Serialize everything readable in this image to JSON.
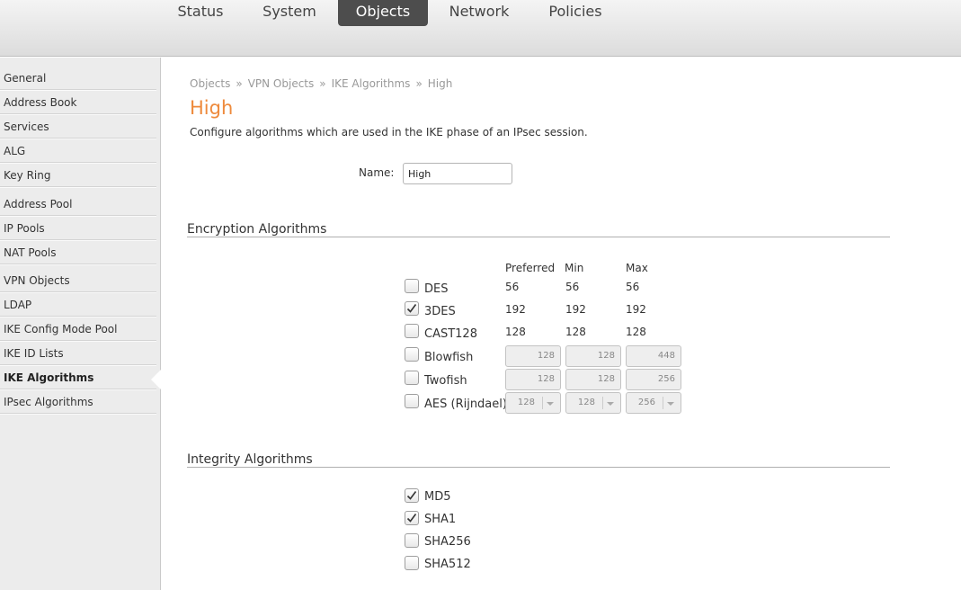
{
  "nav": {
    "tabs": [
      {
        "label": "Status",
        "active": false
      },
      {
        "label": "System",
        "active": false
      },
      {
        "label": "Objects",
        "active": true
      },
      {
        "label": "Network",
        "active": false
      },
      {
        "label": "Policies",
        "active": false
      }
    ]
  },
  "sidebar": {
    "items": [
      {
        "label": "General",
        "active": false
      },
      {
        "label": "Address Book",
        "active": false
      },
      {
        "label": "Services",
        "active": false
      },
      {
        "label": "ALG",
        "active": false
      },
      {
        "label": "Key Ring",
        "active": false
      },
      {
        "label": "Address Pool",
        "active": false
      },
      {
        "label": "IP Pools",
        "active": false
      },
      {
        "label": "NAT Pools",
        "active": false
      },
      {
        "label": "VPN Objects",
        "active": false
      },
      {
        "label": "LDAP",
        "active": false
      },
      {
        "label": "IKE Config Mode Pool",
        "active": false
      },
      {
        "label": "IKE ID Lists",
        "active": false
      },
      {
        "label": "IKE Algorithms",
        "active": true
      },
      {
        "label": "IPsec Algorithms",
        "active": false
      }
    ]
  },
  "breadcrumb": {
    "items": [
      "Objects",
      "VPN Objects",
      "IKE Algorithms",
      "High"
    ],
    "separator": "»"
  },
  "page": {
    "title": "High",
    "description": "Configure algorithms which are used in the IKE phase of an IPsec session."
  },
  "form": {
    "name_label": "Name:",
    "name_value": "High"
  },
  "encryption": {
    "title": "Encryption Algorithms",
    "columns": {
      "preferred": "Preferred",
      "min": "Min",
      "max": "Max"
    },
    "algorithms": [
      {
        "name": "DES",
        "checked": false,
        "preferred": "56",
        "min": "56",
        "max": "56"
      },
      {
        "name": "3DES",
        "checked": true,
        "preferred": "192",
        "min": "192",
        "max": "192"
      },
      {
        "name": "CAST128",
        "checked": false,
        "preferred": "128",
        "min": "128",
        "max": "128"
      },
      {
        "name": "Blowfish",
        "checked": false,
        "preferred": "128",
        "min": "128",
        "max": "448"
      },
      {
        "name": "Twofish",
        "checked": false,
        "preferred": "128",
        "min": "128",
        "max": "256"
      },
      {
        "name": "AES (Rijndael)",
        "checked": false,
        "preferred": "128",
        "min": "128",
        "max": "256"
      }
    ]
  },
  "integrity": {
    "title": "Integrity Algorithms",
    "algorithms": [
      {
        "name": "MD5",
        "checked": true
      },
      {
        "name": "SHA1",
        "checked": true
      },
      {
        "name": "SHA256",
        "checked": false
      },
      {
        "name": "SHA512",
        "checked": false
      }
    ]
  },
  "colors": {
    "accent": "#ee8a3c",
    "active_tab": "#4d4d4d",
    "sidebar_bg": "#ececec"
  }
}
